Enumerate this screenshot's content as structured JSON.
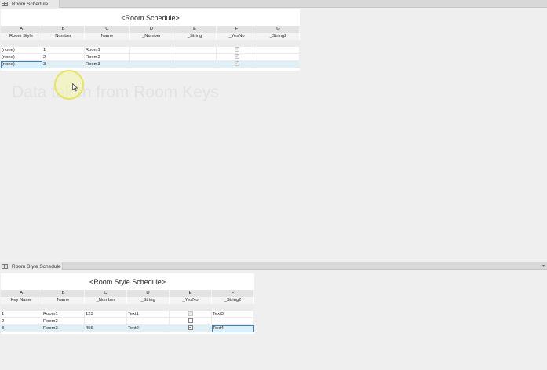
{
  "top_pane": {
    "tab_label": "Room Schedule",
    "schedule": {
      "title": "<Room Schedule>",
      "column_letters": [
        "A",
        "B",
        "C",
        "D",
        "E",
        "F",
        "G"
      ],
      "column_headers": [
        "Room Style",
        "Number",
        "Name",
        "_Number",
        "_String",
        "_YesNo",
        "_String2"
      ],
      "rows": [
        {
          "cells": [
            "(none)",
            "1",
            "Room1",
            "",
            "",
            "",
            ""
          ],
          "yesno_checked": true
        },
        {
          "cells": [
            "(none)",
            "2",
            "Room2",
            "",
            "",
            "",
            ""
          ],
          "yesno_checked": true
        },
        {
          "cells": [
            "(none)",
            "3",
            "Room3",
            "",
            "",
            "",
            ""
          ],
          "yesno_checked": true
        }
      ]
    },
    "overlay_text": "Data taken from Room Keys"
  },
  "bottom_pane": {
    "tab_label": "Room Style Schedule",
    "schedule": {
      "title": "<Room Style Schedule>",
      "column_letters": [
        "A",
        "B",
        "C",
        "D",
        "E",
        "F"
      ],
      "column_headers": [
        "Key Name",
        "Name",
        "_Number",
        "_String",
        "_YesNo",
        "_String2"
      ],
      "rows": [
        {
          "cells": [
            "1",
            "Room1",
            "123",
            "Text1",
            "",
            "Text3"
          ],
          "yesno_checked": true
        },
        {
          "cells": [
            "2",
            "Room2",
            "",
            "",
            "",
            ""
          ],
          "yesno_checked": false
        },
        {
          "cells": [
            "3",
            "Room3",
            "456",
            "Text2",
            "",
            "Text4"
          ],
          "yesno_checked": true
        }
      ]
    }
  },
  "icons": {
    "schedule_tab_icon": "schedule-grid-icon",
    "pane_dropdown_icon": "chevron-down-icon",
    "cursor_icon": "mouse-pointer-icon",
    "click_highlight": "click-highlight-ring"
  },
  "colors": {
    "selection_fill": "#dfeff6",
    "active_cell_border": "#3c7fb8",
    "click_ring": "#e6e35e"
  }
}
